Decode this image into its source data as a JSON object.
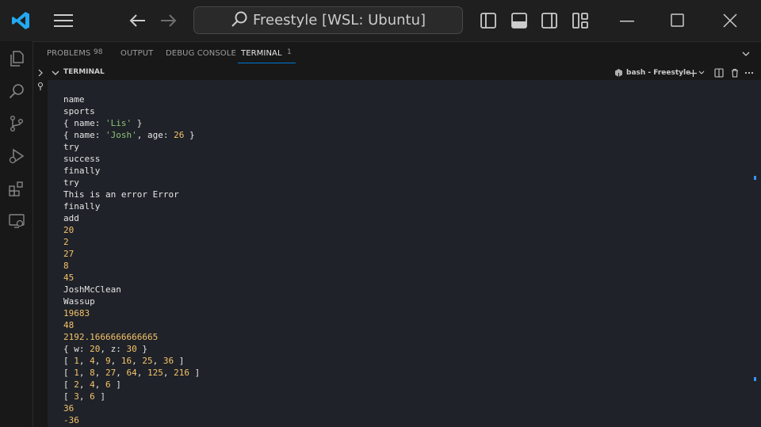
{
  "titlebar": {
    "search_text": "Freestyle [WSL: Ubuntu]",
    "icons": [
      "vscode-logo",
      "menu-icon",
      "back-arrow-icon",
      "forward-arrow-icon",
      "search-icon",
      "toggle-primary-sidebar-icon",
      "toggle-panel-icon",
      "toggle-secondary-sidebar-icon",
      "customize-layout-icon",
      "minimize-icon",
      "maximize-icon",
      "close-icon"
    ]
  },
  "activitybar": {
    "icons": [
      "explorer-icon",
      "search-icon",
      "source-control-icon",
      "run-debug-icon",
      "extensions-icon",
      "remote-explorer-icon"
    ]
  },
  "panel": {
    "tabs": [
      {
        "label": "PROBLEMS",
        "badge": "98"
      },
      {
        "label": "OUTPUT"
      },
      {
        "label": "DEBUG CONSOLE"
      },
      {
        "label": "TERMINAL",
        "badge": "1"
      }
    ],
    "active_tab": "TERMINAL"
  },
  "terminal": {
    "section_title": "TERMINAL",
    "instance_label": "bash - Freestyle",
    "lines": [
      "name",
      "sports",
      "{ name: 'Lis' }",
      "{ name: 'Josh', age: 26 }",
      "try",
      "success",
      "finally",
      "try",
      "This is an error Error",
      "finally",
      "add",
      "20",
      "2",
      "27",
      "8",
      "45",
      "JoshMcClean",
      "Wassup",
      "19683",
      "48",
      "2192.1666666666665",
      "{ w: 20, z: 30 }",
      "[ 1, 4, 9, 16, 25, 36 ]",
      "[ 1, 8, 27, 64, 125, 216 ]",
      "[ 2, 4, 6 ]",
      "[ 3, 6 ]",
      "36",
      "-36"
    ]
  },
  "colors": {
    "accent": "#0078d4",
    "number": "#f5c36b",
    "string": "#8ec27a",
    "vscode_blue": "#23a9f2"
  }
}
